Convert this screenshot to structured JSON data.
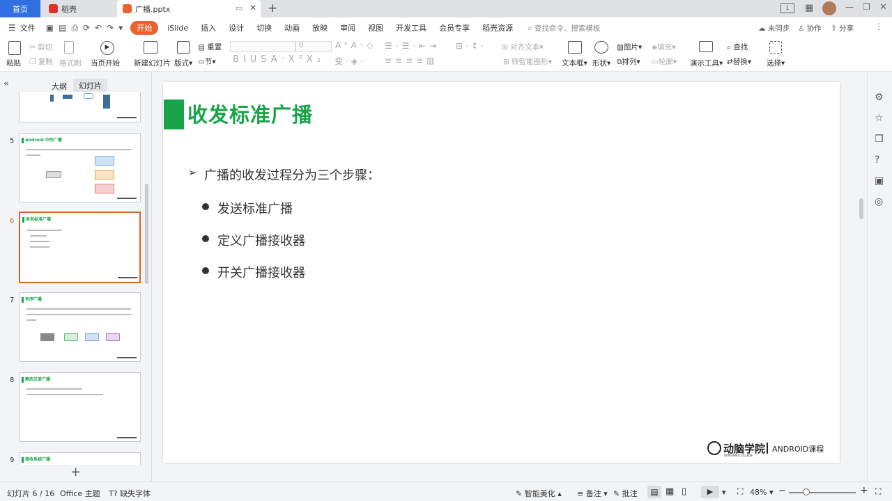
{
  "tabs": {
    "home": "首页",
    "docer": "稻壳",
    "file": "广播.pptx"
  },
  "menu": {
    "file": "文件",
    "items": [
      "开始",
      "iSlide",
      "插入",
      "设计",
      "切换",
      "动画",
      "放映",
      "审阅",
      "视图",
      "开发工具",
      "会员专享",
      "稻壳资源"
    ],
    "search_placeholder": "查找命令、搜索模板",
    "sync": "未同步",
    "collab": "协作",
    "share": "分享"
  },
  "ribbon": {
    "paste": "粘贴",
    "cut": "剪切",
    "copy": "复制",
    "format_painter": "格式刷",
    "play_from_current": "当页开始",
    "new_slide": "新建幻灯片",
    "layout": "版式",
    "reset": "重置",
    "section": "节",
    "font_size": "0",
    "align_text": "对齐文本",
    "smart_art": "转智能图形",
    "textbox": "文本框",
    "shape": "形状",
    "picture": "图片",
    "fill": "填充",
    "arrange": "排列",
    "outline": "轮廓",
    "present_tool": "演示工具",
    "find": "查找",
    "replace": "替换",
    "select": "选择"
  },
  "left_panel": {
    "outline_tab": "大纲",
    "slides_tab": "幻灯片",
    "thumbs": [
      {
        "num": "5",
        "title": "Android 中的广播"
      },
      {
        "num": "6",
        "title": "收发标准广播"
      },
      {
        "num": "7",
        "title": "有序广播"
      },
      {
        "num": "8",
        "title": "静态注册广播"
      },
      {
        "num": "9",
        "title": "接收系统广播"
      }
    ],
    "add_label": "+"
  },
  "slide": {
    "title": "收发标准广播",
    "intro": "广播的收发过程分为三个步骤：",
    "steps": [
      "发送标准广播",
      "定义广播接收器",
      "开关广播接收器"
    ],
    "brand": "动脑学院",
    "brand_sub": "DONGNAO COLLEGE",
    "course": "ANDROID课程"
  },
  "status": {
    "slide_info": "幻灯片 6 / 16",
    "theme": "Office 主题",
    "missing_font": "缺失字体",
    "beautify": "智能美化",
    "notes": "备注",
    "comment": "批注",
    "zoom": "48%"
  },
  "colors": {
    "accent_green": "#1aa44a",
    "brand_orange": "#e9622f",
    "selected_border": "#d4662c",
    "home_blue": "#2f6fe0"
  }
}
